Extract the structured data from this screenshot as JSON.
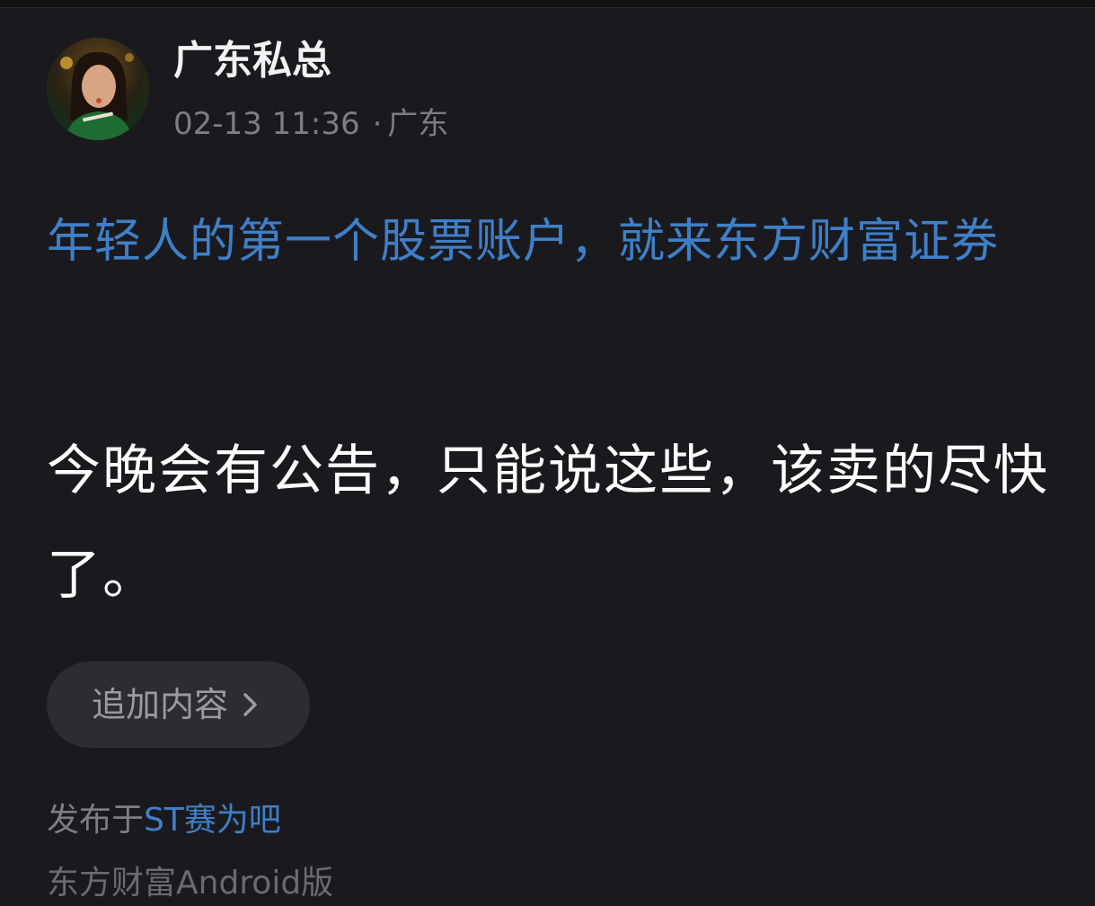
{
  "post": {
    "author": "广东私总",
    "time": "02-13 11:36",
    "separator": "·",
    "location": "广东",
    "promo_text": "年轻人的第一个股票账户，就来东方财富证券",
    "content_text": "今晚会有公告，只能说这些，该卖的尽快了。",
    "append_button_label": "追加内容",
    "append_button_icon": "chevron-right-icon",
    "published_prefix": "发布于",
    "board_name": "ST赛为吧",
    "source": "东方财富Android版"
  },
  "colors": {
    "background": "#1a1a1e",
    "promo": "#3f7fc8",
    "content": "#ffffff",
    "meta": "#7d7d82"
  }
}
